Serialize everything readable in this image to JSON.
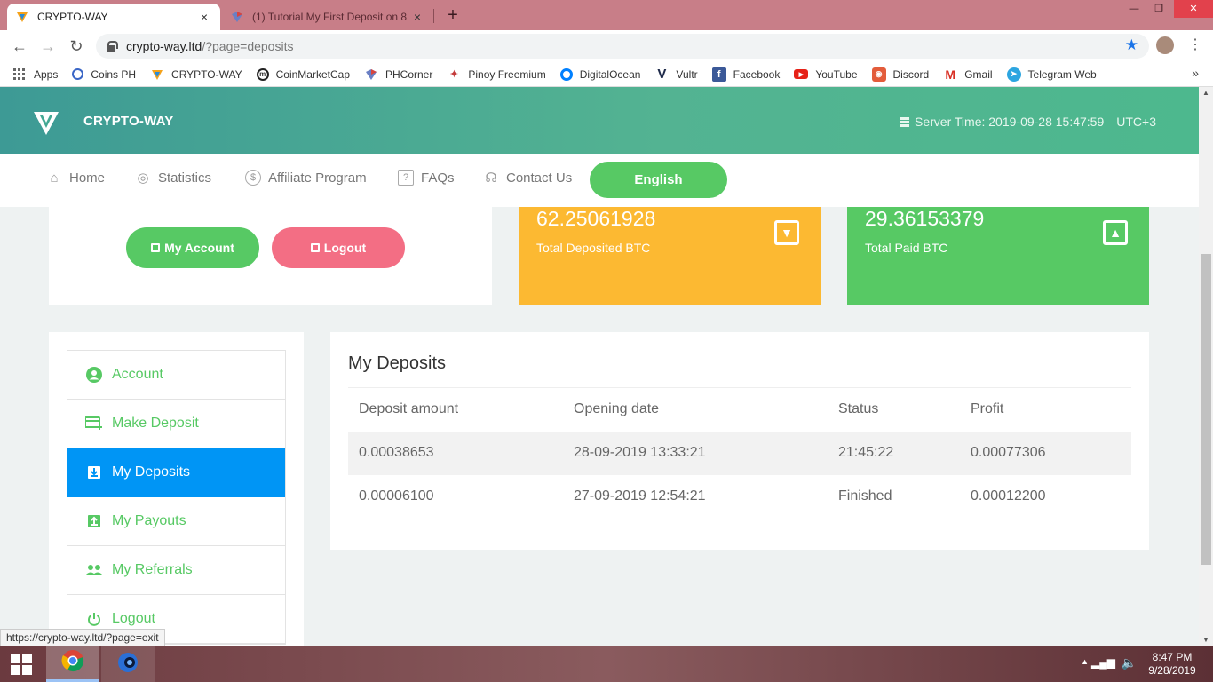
{
  "browser": {
    "tabs": [
      {
        "title": "CRYPTO-WAY",
        "active": true
      },
      {
        "title": "(1) Tutorial My First Deposit on 8",
        "active": false
      }
    ],
    "close_tab_glyph": "×",
    "new_tab_glyph": "+",
    "window_controls": {
      "minimize": "—",
      "maximize": "❐",
      "close": "✕"
    },
    "url_host": "crypto-way.ltd",
    "url_path": "/?page=deposits",
    "bookmarks": [
      {
        "label": "Apps",
        "icon": "apps-grid-icon"
      },
      {
        "label": "Coins PH",
        "icon": "coins-ph-icon"
      },
      {
        "label": "CRYPTO-WAY",
        "icon": "crypto-way-icon"
      },
      {
        "label": "CoinMarketCap",
        "icon": "coinmarketcap-icon"
      },
      {
        "label": "PHCorner",
        "icon": "phcorner-icon"
      },
      {
        "label": "Pinoy Freemium",
        "icon": "pinoy-freemium-icon"
      },
      {
        "label": "DigitalOcean",
        "icon": "digitalocean-icon"
      },
      {
        "label": "Vultr",
        "icon": "vultr-icon"
      },
      {
        "label": "Facebook",
        "icon": "facebook-icon"
      },
      {
        "label": "YouTube",
        "icon": "youtube-icon"
      },
      {
        "label": "Discord",
        "icon": "discord-icon"
      },
      {
        "label": "Gmail",
        "icon": "gmail-icon"
      },
      {
        "label": "Telegram Web",
        "icon": "telegram-icon"
      }
    ],
    "bookmarks_more": "»",
    "status_url": "https://crypto-way.ltd/?page=exit"
  },
  "site": {
    "brand": "CRYPTO-WAY",
    "server_time": "Server Time: 2019-09-28 15:47:59",
    "timezone": "UTC+3",
    "nav": [
      {
        "label": "Home",
        "icon": "home-icon"
      },
      {
        "label": "Statistics",
        "icon": "statistics-icon"
      },
      {
        "label": "Affiliate Program",
        "icon": "dollar-icon"
      },
      {
        "label": "FAQs",
        "icon": "faq-icon"
      },
      {
        "label": "Contact Us",
        "icon": "headset-icon"
      }
    ],
    "language": "English",
    "my_account_label": "My Account",
    "logout_label": "Logout",
    "total_deposited_value": "62.25061928",
    "total_deposited_label": "Total Deposited BTC",
    "total_paid_value": "29.36153379",
    "total_paid_label": "Total Paid BTC",
    "colors": {
      "accent_green": "#57c964",
      "active_blue": "#0095f5",
      "orange": "#fcb932",
      "pink": "#f36e84"
    }
  },
  "sidebar": {
    "items": [
      {
        "label": "Account",
        "icon": "user-circle-icon"
      },
      {
        "label": "Make Deposit",
        "icon": "deposit-card-icon"
      },
      {
        "label": "My Deposits",
        "icon": "download-box-icon",
        "active": true
      },
      {
        "label": "My Payouts",
        "icon": "upload-box-icon"
      },
      {
        "label": "My Referrals",
        "icon": "users-icon"
      },
      {
        "label": "Logout",
        "icon": "power-icon"
      }
    ]
  },
  "deposits": {
    "title": "My Deposits",
    "columns": [
      "Deposit amount",
      "Opening date",
      "Status",
      "Profit"
    ],
    "rows": [
      [
        "0.00038653",
        "28-09-2019 13:33:21",
        "21:45:22",
        "0.00077306"
      ],
      [
        "0.00006100",
        "27-09-2019 12:54:21",
        "Finished",
        "0.00012200"
      ]
    ]
  },
  "taskbar": {
    "time": "8:47 PM",
    "date": "9/28/2019"
  }
}
